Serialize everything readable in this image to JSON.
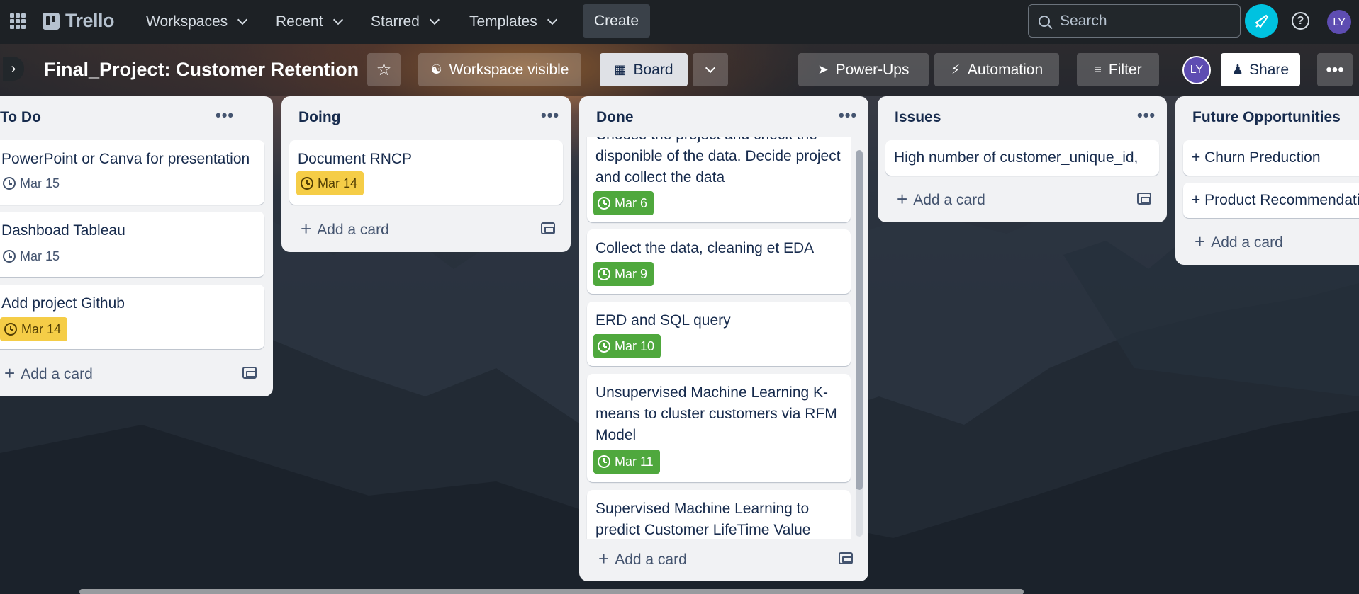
{
  "nav": {
    "logo": "Trello",
    "workspaces": "Workspaces",
    "recent": "Recent",
    "starred": "Starred",
    "templates": "Templates",
    "create": "Create",
    "search_placeholder": "Search",
    "avatar": "LY",
    "help": "?"
  },
  "board": {
    "title": "Final_Project: Customer Retention",
    "visibility": "Workspace visible",
    "view": "Board",
    "powerups": "Power-Ups",
    "automation": "Automation",
    "filter": "Filter",
    "member": "LY",
    "share": "Share",
    "more": "•••"
  },
  "add_card_label": "Add a card",
  "list_menu": "•••",
  "lists": [
    {
      "title": "To Do",
      "cards": [
        {
          "title": "PowerPoint or Canva for presentation",
          "due": "Mar 15",
          "due_status": "none"
        },
        {
          "title": "Dashboad Tableau",
          "due": "Mar 15",
          "due_status": "none"
        },
        {
          "title": "Add project Github",
          "due": "Mar 14",
          "due_status": "due-soon"
        }
      ]
    },
    {
      "title": "Doing",
      "cards": [
        {
          "title": "Document RNCP",
          "due": "Mar 14",
          "due_status": "due-soon"
        }
      ]
    },
    {
      "title": "Done",
      "cards": [
        {
          "title": "Choose the project and check the disponible of the data. Decide project and collect the data",
          "due": "Mar 6",
          "due_status": "complete"
        },
        {
          "title": "Collect the data, cleaning et EDA",
          "due": "Mar 9",
          "due_status": "complete"
        },
        {
          "title": "ERD and SQL query",
          "due": "Mar 10",
          "due_status": "complete"
        },
        {
          "title": "Unsupervised Machine Learning K-means to cluster customers via RFM Model",
          "due": "Mar 11",
          "due_status": "complete"
        },
        {
          "title": "Supervised Machine Learning to predict Customer LifeTime Value",
          "due": "",
          "due_status": "none"
        }
      ]
    },
    {
      "title": "Issues",
      "cards": [
        {
          "title": "High number of customer_unique_id,"
        }
      ]
    },
    {
      "title": "Future Opportunities",
      "cards": [
        {
          "title": "+ Churn Preduction"
        },
        {
          "title": "+ Product Recommendati"
        }
      ]
    }
  ],
  "colors": {
    "nav_bg": "#1d2125",
    "list_bg": "#f1f2f4",
    "due_soon": "#f5cd47",
    "complete": "#4fa83d",
    "avatar": "#5e4db2",
    "accent": "#00c2e0"
  }
}
